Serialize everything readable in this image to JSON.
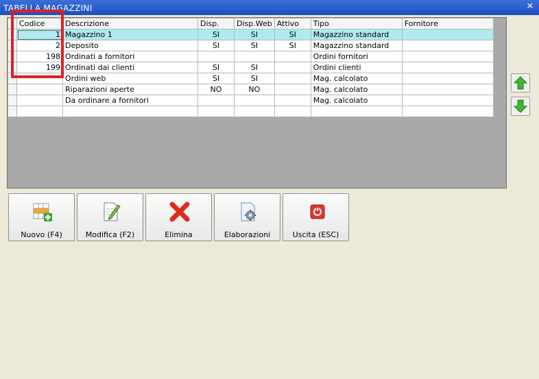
{
  "window": {
    "title": "TABELLA MAGAZZINI",
    "close_glyph": "✕"
  },
  "grid": {
    "columns": [
      "Codice",
      "Descrizione",
      "Disp.",
      "Disp.Web",
      "Attivo",
      "Tipo",
      "Fornitore"
    ],
    "rows": [
      {
        "codice": "1",
        "descrizione": "Magazzino 1",
        "disp": "SI",
        "disp_web": "SI",
        "attivo": "SI",
        "tipo": "Magazzino standard",
        "fornitore": ""
      },
      {
        "codice": "2",
        "descrizione": "Deposito",
        "disp": "SI",
        "disp_web": "SI",
        "attivo": "SI",
        "tipo": "Magazzino standard",
        "fornitore": ""
      },
      {
        "codice": "198",
        "descrizione": "Ordinati a fornitori",
        "disp": "",
        "disp_web": "",
        "attivo": "",
        "tipo": "Ordini fornitori",
        "fornitore": ""
      },
      {
        "codice": "199",
        "descrizione": "Ordinati dai clienti",
        "disp": "SI",
        "disp_web": "SI",
        "attivo": "",
        "tipo": "Ordini clienti",
        "fornitore": ""
      },
      {
        "codice": "",
        "descrizione": "Ordini web",
        "disp": "SI",
        "disp_web": "SI",
        "attivo": "",
        "tipo": "Mag. calcolato",
        "fornitore": ""
      },
      {
        "codice": "",
        "descrizione": "Riparazioni aperte",
        "disp": "NO",
        "disp_web": "NO",
        "attivo": "",
        "tipo": "Mag. calcolato",
        "fornitore": ""
      },
      {
        "codice": "",
        "descrizione": "Da ordinare a fornitori",
        "disp": "",
        "disp_web": "",
        "attivo": "",
        "tipo": "Mag. calcolato",
        "fornitore": ""
      },
      {
        "codice": "",
        "descrizione": "",
        "disp": "",
        "disp_web": "",
        "attivo": "",
        "tipo": "",
        "fornitore": ""
      }
    ],
    "selected_row_index": 0,
    "selected_row_color": "#aeeaf0"
  },
  "side_buttons": {
    "up_icon": "arrow-up-icon",
    "down_icon": "arrow-down-icon",
    "accent": "#3aa532"
  },
  "toolbar": {
    "new_label": "Nuovo (F4)",
    "edit_label": "Modifica (F2)",
    "delete_label": "Elimina",
    "process_label": "Elaborazioni",
    "exit_label": "Uscita (ESC)"
  },
  "highlight_color": "#e61e1e"
}
